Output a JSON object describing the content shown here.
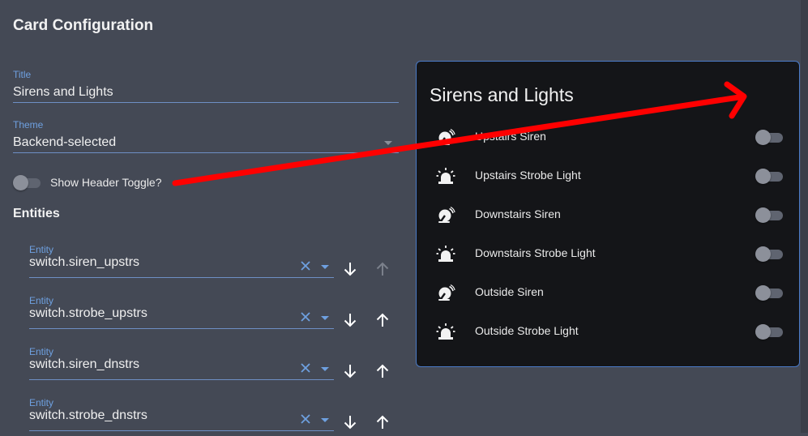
{
  "dialog": {
    "title": "Card Configuration"
  },
  "form": {
    "title_field": {
      "label": "Title",
      "value": "Sirens and Lights"
    },
    "theme_field": {
      "label": "Theme",
      "value": "Backend-selected"
    },
    "header_toggle": {
      "label": "Show Header Toggle?",
      "checked": false
    },
    "entities_heading": "Entities",
    "entities": [
      {
        "label": "Entity",
        "value": "switch.siren_upstrs"
      },
      {
        "label": "Entity",
        "value": "switch.strobe_upstrs"
      },
      {
        "label": "Entity",
        "value": "switch.siren_dnstrs"
      },
      {
        "label": "Entity",
        "value": "switch.strobe_dnstrs"
      }
    ]
  },
  "preview": {
    "title": "Sirens and Lights",
    "rows": [
      {
        "icon": "bell-icon",
        "name": "Upstairs Siren",
        "on": false
      },
      {
        "icon": "alarm-light-icon",
        "name": "Upstairs Strobe Light",
        "on": false
      },
      {
        "icon": "bell-icon",
        "name": "Downstairs Siren",
        "on": false
      },
      {
        "icon": "alarm-light-icon",
        "name": "Downstairs Strobe Light",
        "on": false
      },
      {
        "icon": "bell-icon",
        "name": "Outside Siren",
        "on": false
      },
      {
        "icon": "alarm-light-icon",
        "name": "Outside Strobe Light",
        "on": false
      }
    ]
  },
  "colors": {
    "background": "#444955",
    "accent": "#6ea0e0",
    "card_background": "#141518",
    "card_border": "#4a7ac7",
    "annotation_arrow": "#ff0000"
  }
}
